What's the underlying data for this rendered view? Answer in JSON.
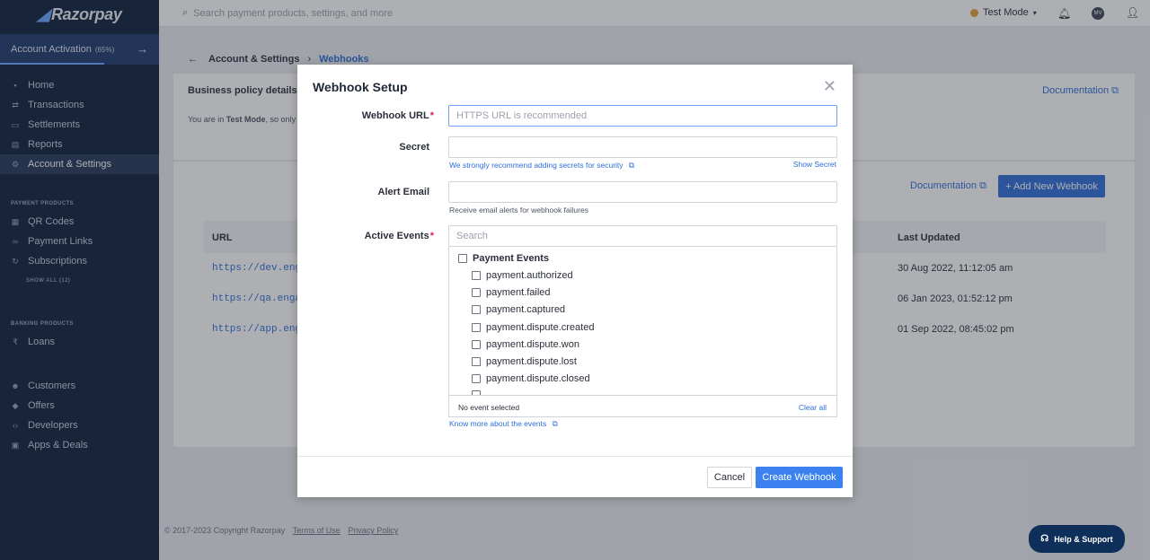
{
  "sidebar": {
    "logo": "Razorpay",
    "activation": {
      "label": "Account Activation",
      "percent": "(65%)"
    },
    "main_items": [
      {
        "label": "Home",
        "icon": "home-icon"
      },
      {
        "label": "Transactions",
        "icon": "transactions-icon"
      },
      {
        "label": "Settlements",
        "icon": "settlements-icon"
      },
      {
        "label": "Reports",
        "icon": "reports-icon"
      },
      {
        "label": "Account & Settings",
        "icon": "gear-icon",
        "active": true
      }
    ],
    "payment_heading": "PAYMENT PRODUCTS",
    "payment_items": [
      {
        "label": "QR Codes",
        "icon": "qr-icon"
      },
      {
        "label": "Payment Links",
        "icon": "link-icon"
      },
      {
        "label": "Subscriptions",
        "icon": "refresh-icon"
      }
    ],
    "show_all": "SHOW ALL (12)",
    "banking_heading": "BANKING PRODUCTS",
    "banking_items": [
      {
        "label": "Loans",
        "icon": "rupee-icon"
      }
    ],
    "other_items": [
      {
        "label": "Customers",
        "icon": "customers-icon"
      },
      {
        "label": "Offers",
        "icon": "tag-icon"
      },
      {
        "label": "Developers",
        "icon": "code-icon"
      },
      {
        "label": "Apps & Deals",
        "icon": "apps-icon"
      }
    ]
  },
  "topbar": {
    "search_placeholder": "Search payment products, settings, and more",
    "mode": "Test Mode",
    "avatar_initials": "MV"
  },
  "breadcrumb": {
    "parent": "Account & Settings",
    "current": "Webhooks"
  },
  "business_card": {
    "title": "Business policy details",
    "documentation": "Documentation",
    "notice_prefix": "You are in ",
    "notice_mode": "Test Mode",
    "notice_suffix": ", so only"
  },
  "webhooks": {
    "documentation": "Documentation",
    "add_button": "+ Add New Webhook",
    "columns": {
      "url": "URL",
      "last_updated": "Last Updated"
    },
    "rows": [
      {
        "url": "https://dev.engz",
        "updated": "30 Aug 2022, 11:12:05 am"
      },
      {
        "url": "https://qa.engat",
        "updated": "06 Jan 2023, 01:52:12 pm"
      },
      {
        "url": "https://app.engz",
        "updated": "01 Sep 2022, 08:45:02 pm"
      }
    ]
  },
  "footer": {
    "copyright": "© 2017-2023 Copyright Razorpay",
    "terms": "Terms of Use",
    "privacy": "Privacy Policy"
  },
  "help": "Help & Support",
  "modal": {
    "title": "Webhook Setup",
    "url_label": "Webhook URL",
    "url_placeholder": "HTTPS URL is recommended",
    "secret_label": "Secret",
    "secret_hint": "We strongly recommend adding secrets for security",
    "show_secret": "Show Secret",
    "email_label": "Alert Email",
    "email_hint": "Receive email alerts for webhook failures",
    "events_label": "Active Events",
    "events_search_placeholder": "Search",
    "event_group": "Payment Events",
    "events": [
      "payment.authorized",
      "payment.failed",
      "payment.captured",
      "payment.dispute.created",
      "payment.dispute.won",
      "payment.dispute.lost",
      "payment.dispute.closed"
    ],
    "selection_status": "No event selected",
    "clear_all": "Clear all",
    "know_more": "Know more about the events",
    "cancel": "Cancel",
    "create": "Create Webhook"
  }
}
